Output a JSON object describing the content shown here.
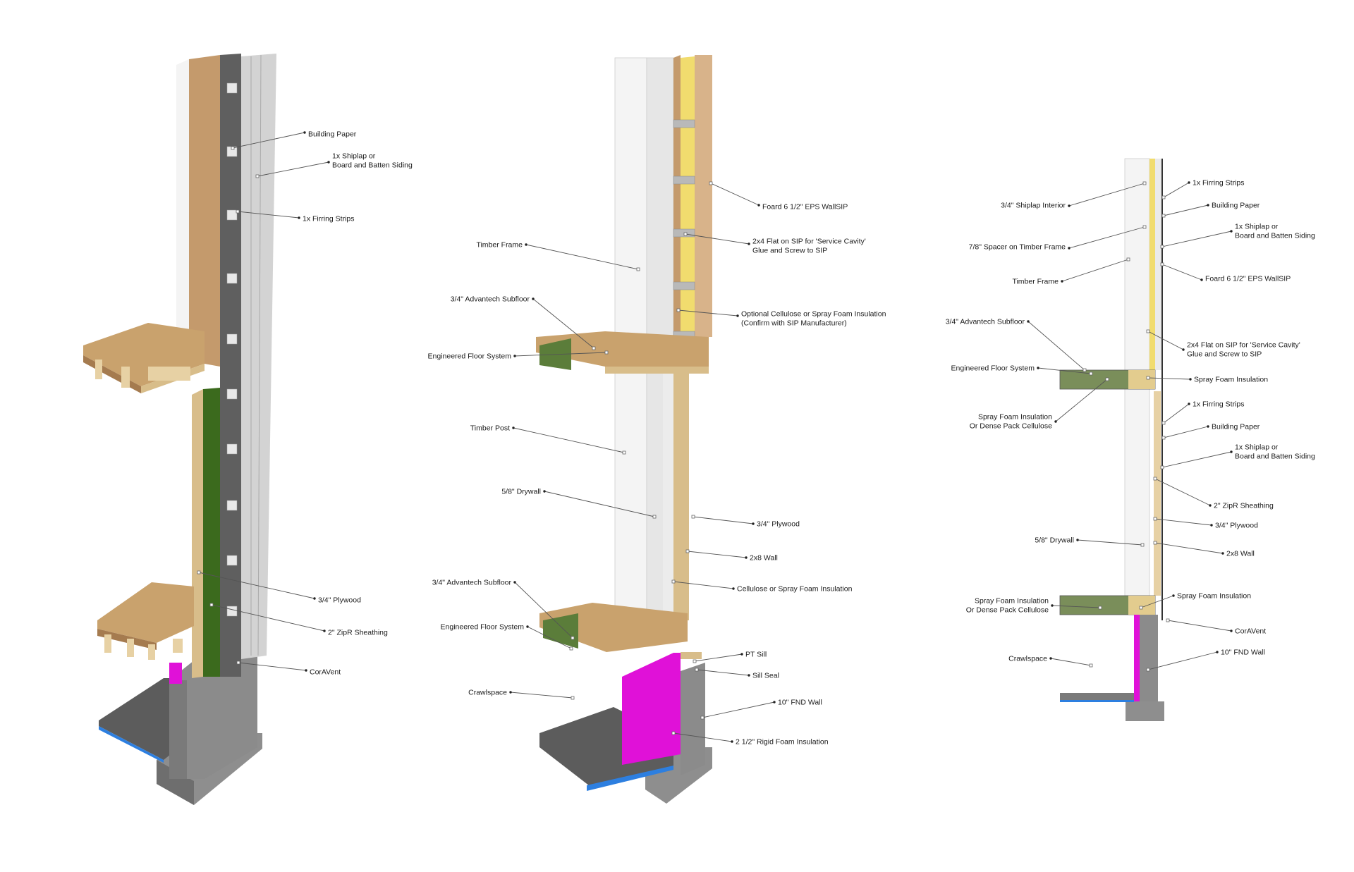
{
  "colors": {
    "osb": "#c49a6c",
    "osb_dark": "#a57b4f",
    "drywall": "#f4f4f4",
    "siding": "#d3d3d3",
    "membrane": "#5f5f5f",
    "zip_green": "#3b6a1d",
    "plywood": "#d8bd8a",
    "sip_foam": "#f1dc6e",
    "concrete": "#8e8e8e",
    "slab": "#5c5c5c",
    "rigid_foam": "#e011d8",
    "vapor_blue": "#2d7fe0"
  },
  "details": [
    {
      "id": "detail-a",
      "labels": [
        {
          "text": "Building Paper"
        },
        {
          "text": "1x Shiplap or\nBoard and Batten Siding"
        },
        {
          "text": "1x Firring Strips"
        },
        {
          "text": "3/4\" Plywood"
        },
        {
          "text": "2\" ZipR Sheathing"
        },
        {
          "text": "CorAVent"
        }
      ]
    },
    {
      "id": "detail-b",
      "labels": [
        {
          "text": "Foard 6 1/2\" EPS WallSIP"
        },
        {
          "text": "2x4 Flat on SIP for 'Service Cavity'\nGlue and Screw to SIP"
        },
        {
          "text": "Timber Frame"
        },
        {
          "text": "Optional Cellulose or Spray Foam Insulation\n(Confirm with SIP Manufacturer)"
        },
        {
          "text": "3/4\" Advantech Subfloor"
        },
        {
          "text": "Engineered Floor System"
        },
        {
          "text": "Timber Post"
        },
        {
          "text": "5/8\" Drywall"
        },
        {
          "text": "3/4\" Plywood"
        },
        {
          "text": "2x8 Wall"
        },
        {
          "text": "Cellulose or Spray Foam Insulation"
        },
        {
          "text": "3/4\" Advantech Subfloor"
        },
        {
          "text": "Engineered Floor System"
        },
        {
          "text": "PT Sill"
        },
        {
          "text": "Sill Seal"
        },
        {
          "text": "Crawlspace"
        },
        {
          "text": "10\" FND Wall"
        },
        {
          "text": "2 1/2\" Rigid Foam Insulation"
        }
      ]
    },
    {
      "id": "detail-c",
      "labels": [
        {
          "text": "1x Firring Strips"
        },
        {
          "text": "3/4\" Shiplap Interior"
        },
        {
          "text": "Building Paper"
        },
        {
          "text": "1x Shiplap or\nBoard and Batten Siding"
        },
        {
          "text": "7/8\" Spacer on Timber Frame"
        },
        {
          "text": "Foard 6 1/2\" EPS WallSIP"
        },
        {
          "text": "Timber Frame"
        },
        {
          "text": "3/4\" Advantech Subfloor"
        },
        {
          "text": "2x4 Flat on SIP for 'Service Cavity'\nGlue and Screw to SIP"
        },
        {
          "text": "Engineered Floor System"
        },
        {
          "text": "Spray Foam Insulation"
        },
        {
          "text": "Spray Foam Insulation\nOr Dense Pack Cellulose"
        },
        {
          "text": "1x Firring Strips"
        },
        {
          "text": "Building Paper"
        },
        {
          "text": "1x Shiplap or\nBoard and Batten Siding"
        },
        {
          "text": "2\" ZipR Sheathing"
        },
        {
          "text": "3/4\" Plywood"
        },
        {
          "text": "5/8\" Drywall"
        },
        {
          "text": "2x8 Wall"
        },
        {
          "text": "Spray Foam Insulation\nOr Dense Pack Cellulose"
        },
        {
          "text": "Spray Foam Insulation"
        },
        {
          "text": "CorAVent"
        },
        {
          "text": "10\" FND Wall"
        },
        {
          "text": "Crawlspace"
        }
      ]
    }
  ]
}
